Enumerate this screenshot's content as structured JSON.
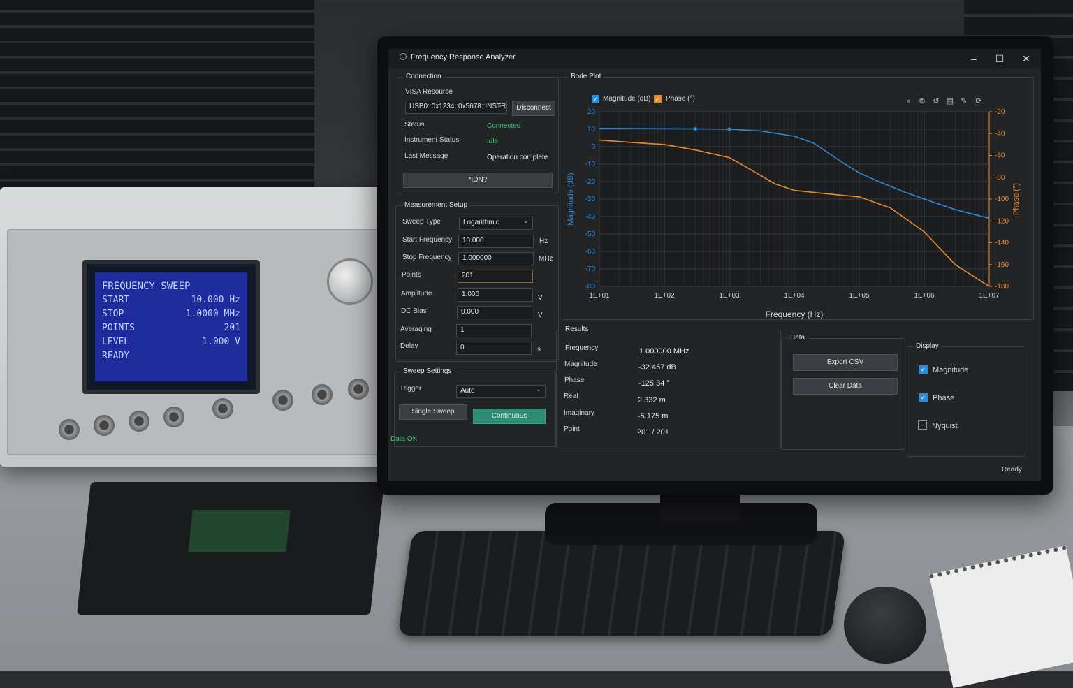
{
  "window": {
    "title": "Frequency Response Analyzer",
    "min": "–",
    "max": "☐",
    "close": "✕"
  },
  "connection": {
    "group_label": "Connection",
    "visa_label": "VISA Resource",
    "visa_value": "USB0::0x1234::0x5678::INSTR",
    "disconnect": "Disconnect",
    "status_label": "Status",
    "status_value": "Connected",
    "inst_status_label": "Instrument Status",
    "inst_status_value": "Idle",
    "last_msg_label": "Last Message",
    "last_msg_value": "Operation complete",
    "idn_button": "*IDN?"
  },
  "measurement": {
    "group_label": "Measurement Setup",
    "sweep_type_label": "Sweep Type",
    "sweep_type_value": "Logarithmic",
    "start_label": "Start Frequency",
    "start_value": "10.000",
    "start_unit": "Hz",
    "stop_label": "Stop Frequency",
    "stop_value": "1.000000",
    "stop_unit": "MHz",
    "points_label": "Points",
    "points_value": "201",
    "amplitude_label": "Amplitude",
    "amplitude_value": "1.000",
    "amplitude_unit": "V",
    "dcbias_label": "DC Bias",
    "dcbias_value": "0.000",
    "dcbias_unit": "V",
    "averaging_label": "Averaging",
    "averaging_value": "1",
    "delay_label": "Delay",
    "delay_value": "0",
    "delay_unit": "s"
  },
  "sweep": {
    "group_label": "Sweep Settings",
    "trigger_label": "Trigger",
    "trigger_value": "Auto",
    "single": "Single Sweep",
    "continuous": "Continuous",
    "data_status": "Data OK"
  },
  "bode": {
    "group_label": "Bode Plot",
    "magnitude_toggle": "Magnitude (dB)",
    "phase_toggle": "Phase (°)",
    "tools": [
      "zoom-out-icon",
      "zoom-in-icon",
      "reset-icon",
      "save-icon",
      "edit-icon",
      "refresh-icon"
    ]
  },
  "results": {
    "group_label": "Results",
    "frequency_label": "Frequency",
    "frequency_value": "1.000000 MHz",
    "magnitude_label": "Magnitude",
    "magnitude_value": "-32.457 dB",
    "phase_label": "Phase",
    "phase_value": "-125.34 °",
    "real_label": "Real",
    "real_value": "2.332 m",
    "imag_label": "Imaginary",
    "imag_value": "-5.175 m",
    "point_label": "Point",
    "point_value": "201 / 201"
  },
  "data_panel": {
    "group_label": "Data",
    "export": "Export CSV",
    "clear": "Clear Data"
  },
  "display": {
    "group_label": "Display",
    "magnitude": "Magnitude",
    "magnitude_checked": true,
    "phase": "Phase",
    "phase_checked": true,
    "nyquist": "Nyquist",
    "nyquist_checked": false
  },
  "statusbar": {
    "text": "Ready"
  },
  "colors": {
    "magnitude": "#2d8ad8",
    "phase": "#ea8b2a",
    "accent": "#2e8b73",
    "ok": "#3ec46d"
  },
  "chart_data": {
    "type": "line",
    "xlabel": "Frequency (Hz)",
    "ylabel": "Magnitude (dB)",
    "y2label": "Phase (°)",
    "x_scale": "log",
    "xlim": [
      10,
      10000000
    ],
    "ylim": [
      -80,
      20
    ],
    "y2lim": [
      -180,
      -20
    ],
    "x_ticks": [
      "1E+01",
      "1E+02",
      "1E+03",
      "1E+04",
      "1E+05",
      "1E+06",
      "1E+07"
    ],
    "y_ticks": [
      20,
      10,
      0,
      -10,
      -20,
      -30,
      -40,
      -50,
      -60,
      -70,
      -80
    ],
    "y2_ticks": [
      -20,
      -40,
      -60,
      -80,
      -100,
      -120,
      -140,
      -160,
      -180
    ],
    "grid": true,
    "legend": "top-left",
    "series": [
      {
        "name": "Magnitude (dB)",
        "axis": "left",
        "x": [
          10,
          30,
          100,
          300,
          1000,
          3000,
          10000,
          20000,
          50000,
          100000,
          200000,
          500000,
          1000000,
          3000000,
          10000000
        ],
        "y": [
          10.5,
          10.4,
          10.3,
          10.2,
          10,
          9,
          6,
          2,
          -8,
          -15,
          -20,
          -26,
          -30,
          -36,
          -41
        ]
      },
      {
        "name": "Phase (°)",
        "axis": "right",
        "x": [
          10,
          30,
          100,
          300,
          1000,
          2000,
          5000,
          10000,
          30000,
          100000,
          300000,
          1000000,
          3000000,
          10000000
        ],
        "y": [
          -46,
          -48,
          -50,
          -55,
          -62,
          -72,
          -86,
          -92,
          -95,
          -98,
          -108,
          -130,
          -160,
          -180
        ]
      }
    ],
    "markers": [
      {
        "series": "Magnitude (dB)",
        "x": [
          300,
          1000
        ]
      }
    ]
  }
}
